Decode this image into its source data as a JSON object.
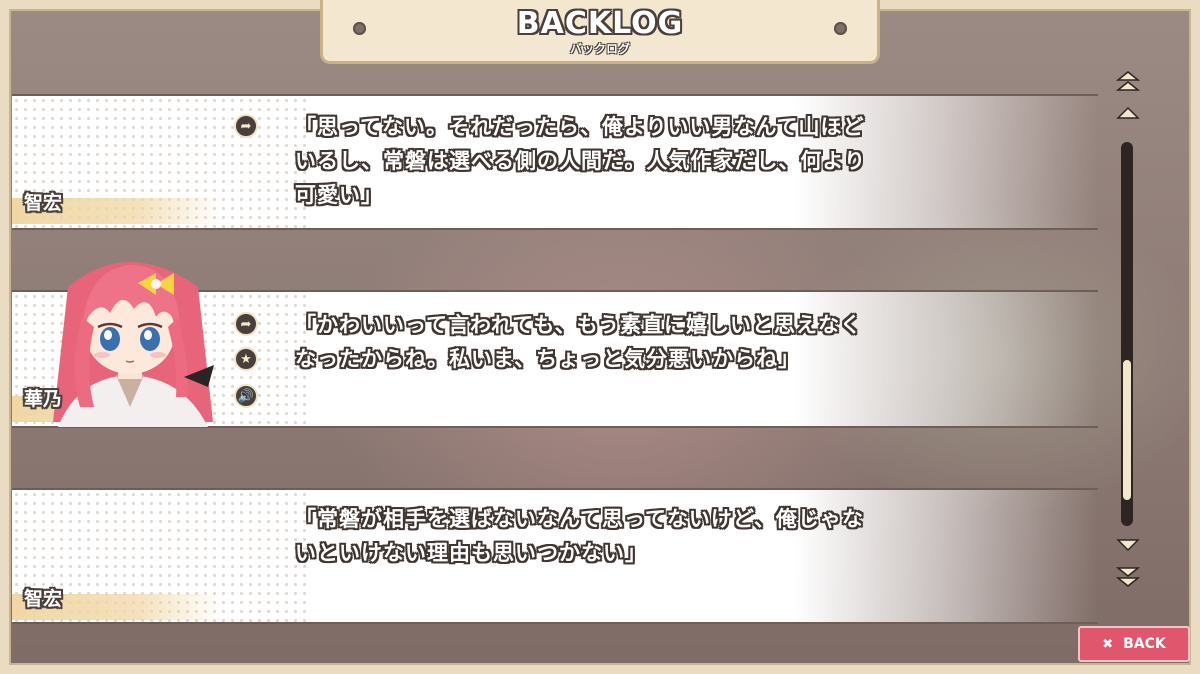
{
  "header": {
    "title": "BACKLOG",
    "subtitle": "バックログ"
  },
  "entries": [
    {
      "speaker": "智宏",
      "text_lines": [
        "「思ってない。それだったら、俺よりいい男なんて山ほど",
        "いるし、常磐は選べる側の人間だ。人気作家だし、何より",
        "可愛い」"
      ],
      "icons": [
        "jump-icon"
      ]
    },
    {
      "speaker": "華乃",
      "text_lines": [
        "「かわいいって言われても、もう素直に嬉しいと思えなく",
        "なったからね。私いま、ちょっと気分悪いからね」"
      ],
      "icons": [
        "jump-icon",
        "star-icon",
        "voice-icon"
      ],
      "has_portrait": true
    },
    {
      "speaker": "智宏",
      "text_lines": [
        "「常磐が相手を選ばないなんて思ってないけど、俺じゃな",
        "いといけない理由も思いつかない」"
      ],
      "icons": []
    }
  ],
  "scrollbar": {
    "position": 0.9
  },
  "back_button": {
    "icon": "close-icon",
    "label": "BACK"
  },
  "colors": {
    "frame": "#e9dcc2",
    "text_outline": "#3f3531",
    "back_button": "#e0566c",
    "scroll_track": "#2e2522"
  }
}
